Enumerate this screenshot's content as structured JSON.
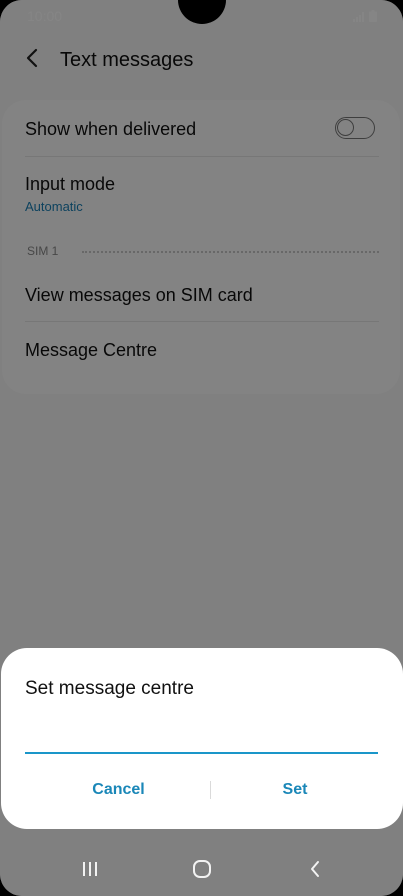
{
  "status_bar": {
    "time": "10:00"
  },
  "app_bar": {
    "title": "Text messages"
  },
  "settings": {
    "show_when_delivered": {
      "label": "Show when delivered",
      "enabled": false
    },
    "input_mode": {
      "label": "Input mode",
      "value": "Automatic"
    },
    "section_sim": "SIM 1",
    "view_sim_messages": "View messages on SIM card",
    "message_centre": "Message Centre"
  },
  "dialog": {
    "title": "Set message centre",
    "input_value": "",
    "cancel_label": "Cancel",
    "set_label": "Set"
  },
  "colors": {
    "accent": "#1a87b8",
    "input_underline": "#1a96c9"
  },
  "icons": {
    "back": "chevron-left-icon",
    "signal": "signal-icon",
    "battery": "battery-icon",
    "recents": "recents-icon",
    "home": "home-icon",
    "nav_back": "nav-back-icon"
  }
}
